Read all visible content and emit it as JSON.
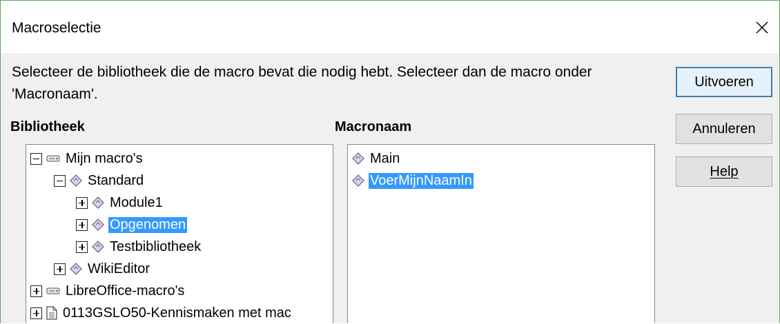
{
  "dialog": {
    "title": "Macroselectie",
    "instruction": "Selecteer de bibliotheek die de macro bevat die nodig hebt. Selecteer dan de macro onder 'Macronaam'."
  },
  "library": {
    "label": "Bibliotheek",
    "items": [
      {
        "label": "Mijn macro's",
        "expander": "minus",
        "icon": "drive-icon",
        "level": 0,
        "selected": false
      },
      {
        "label": "Standard",
        "expander": "minus",
        "icon": "library-icon",
        "level": 1,
        "selected": false
      },
      {
        "label": "Module1",
        "expander": "plus",
        "icon": "module-icon",
        "level": 2,
        "selected": false
      },
      {
        "label": "Opgenomen",
        "expander": "plus",
        "icon": "module-icon",
        "level": 2,
        "selected": true
      },
      {
        "label": "Testbibliotheek",
        "expander": "plus",
        "icon": "module-icon",
        "level": 2,
        "selected": false
      },
      {
        "label": "WikiEditor",
        "expander": "plus",
        "icon": "library-icon",
        "level": 1,
        "selected": false
      },
      {
        "label": "LibreOffice-macro's",
        "expander": "plus",
        "icon": "drive-icon",
        "level": 0,
        "selected": false
      },
      {
        "label": "0113GSLO50-Kennismaken met mac",
        "expander": "plus",
        "icon": "document-icon",
        "level": 0,
        "selected": false
      }
    ]
  },
  "macros": {
    "label": "Macronaam",
    "items": [
      {
        "label": "Main",
        "icon": "macro-icon",
        "selected": false
      },
      {
        "label": "VoerMijnNaamIn",
        "icon": "macro-icon",
        "selected": true
      }
    ]
  },
  "buttons": {
    "run": "Uitvoeren",
    "cancel": "Annuleren",
    "help": "Help"
  },
  "colors": {
    "selection": "#3399ff",
    "window_border": "#5aa55a",
    "default_button_border": "#3c7fb1"
  }
}
